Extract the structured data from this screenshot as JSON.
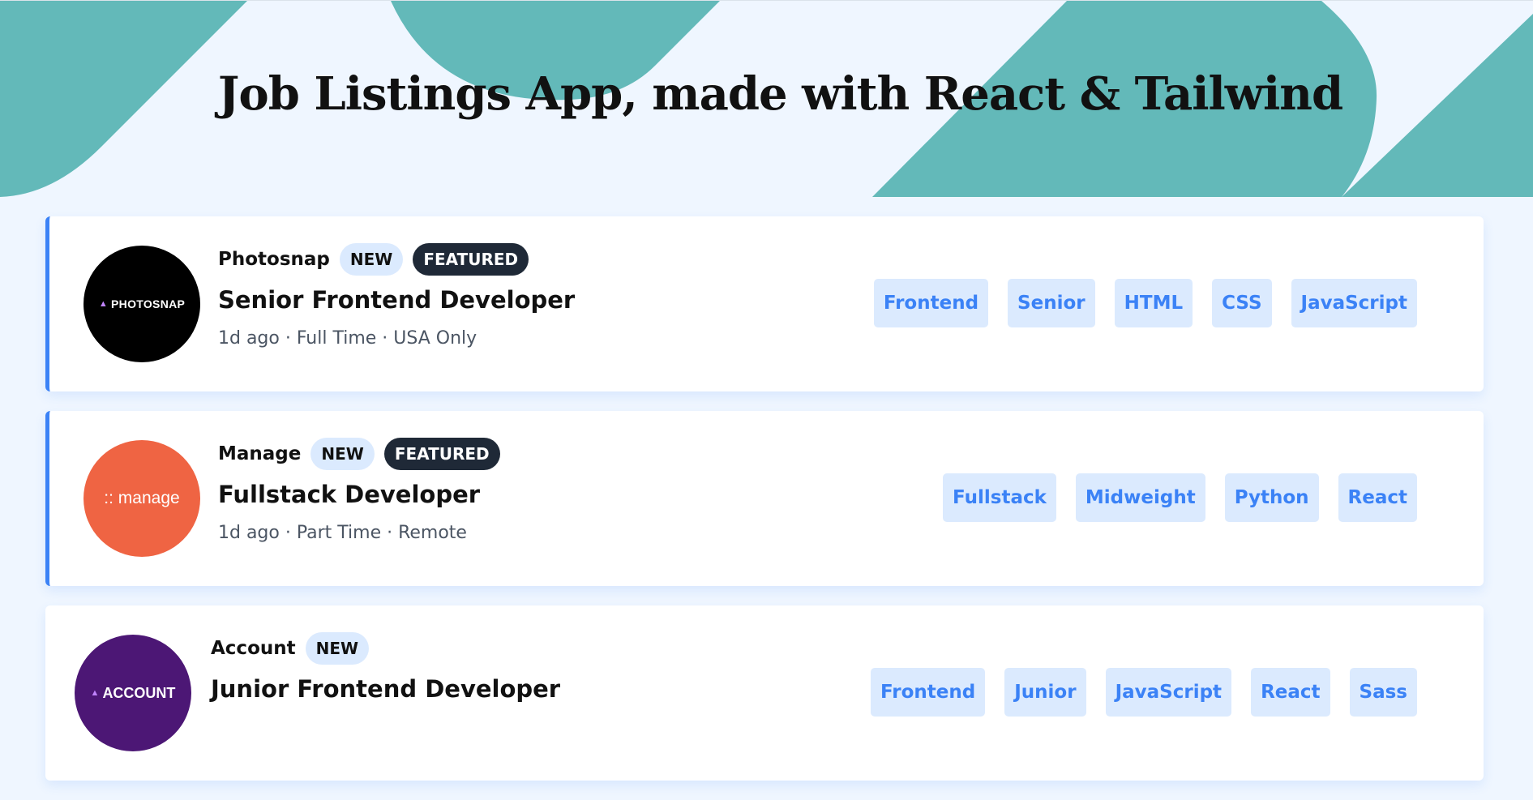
{
  "header": {
    "title": "Job Listings App, made with React & Tailwind",
    "accent_color": "#63b9b9"
  },
  "jobs": [
    {
      "company": "Photosnap",
      "logo_text": "PHOTOSNAP",
      "new_label": "NEW",
      "featured_label": "FEATURED",
      "position": "Senior Frontend Developer",
      "meta": "1d ago · Full Time · USA Only",
      "tags": [
        "Frontend",
        "Senior",
        "HTML",
        "CSS",
        "JavaScript"
      ]
    },
    {
      "company": "Manage",
      "logo_text": ":: manage",
      "new_label": "NEW",
      "featured_label": "FEATURED",
      "position": "Fullstack Developer",
      "meta": "1d ago · Part Time · Remote",
      "tags": [
        "Fullstack",
        "Midweight",
        "Python",
        "React"
      ]
    },
    {
      "company": "Account",
      "logo_text": "ACCOUNT",
      "new_label": "NEW",
      "position": "Junior Frontend Developer",
      "tags": [
        "Frontend",
        "Junior",
        "JavaScript",
        "React",
        "Sass"
      ]
    }
  ],
  "colors": {
    "page_bg": "#eff6ff",
    "tag_bg": "#dbeafe",
    "tag_text": "#3b82f6",
    "featured_bg": "#1f2937",
    "card_border": "#3b82f6"
  }
}
